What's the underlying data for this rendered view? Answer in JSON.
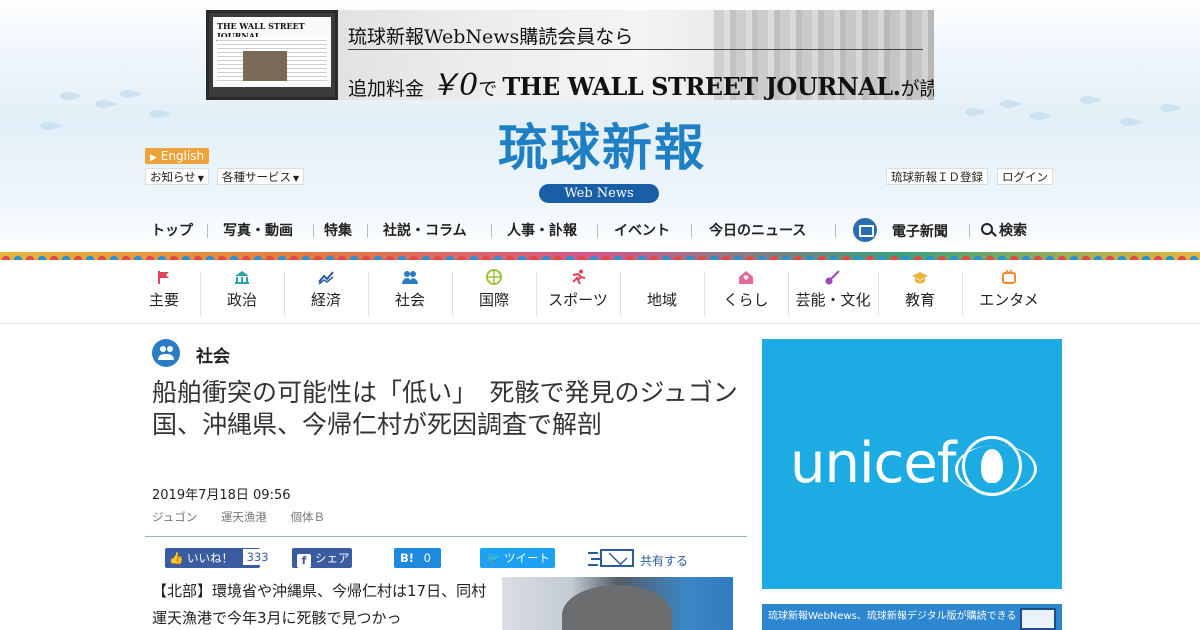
{
  "banner": {
    "line1": "琉球新報WebNews購読会員なら",
    "line2_prefix": "追加料金",
    "line2_yen": "￥0",
    "line2_de": "で",
    "line2_wsj": "THE WALL STREET JOURNAL.",
    "line2_suffix": "が読める",
    "laptop_masthead": "THE WALL STREET JOURNAL."
  },
  "masthead": {
    "logo": "琉球新報",
    "subtitle": "Web News",
    "english": "English",
    "notices": "お知らせ",
    "services": "各種サービス",
    "register": "琉球新報ＩＤ登録",
    "login": "ログイン"
  },
  "mainnav": {
    "items": [
      "トップ",
      "写真・動画",
      "特集",
      "社説・コラム",
      "人事・訃報",
      "イベント",
      "今日のニュース"
    ],
    "edition": "電子新聞",
    "search": "検索"
  },
  "categories": [
    {
      "label": "主要",
      "icon": "flag-icon",
      "color": "#e0455a"
    },
    {
      "label": "政治",
      "icon": "parliament-icon",
      "color": "#2aa4a6"
    },
    {
      "label": "経済",
      "icon": "chart-icon",
      "color": "#2a5d9e"
    },
    {
      "label": "社会",
      "icon": "people-icon",
      "color": "#2a7cc7"
    },
    {
      "label": "国際",
      "icon": "globe-icon",
      "color": "#9bc23c"
    },
    {
      "label": "スポーツ",
      "icon": "runner-icon",
      "color": "#e0455a"
    },
    {
      "label": "地域",
      "icon": "pin-icon",
      "color": "#4bb36b"
    },
    {
      "label": "くらし",
      "icon": "house-icon",
      "color": "#e06a9a"
    },
    {
      "label": "芸能・文化",
      "icon": "sanshin-icon",
      "color": "#9a4bb0"
    },
    {
      "label": "教育",
      "icon": "graduation-cap-icon",
      "color": "#e8b73c"
    },
    {
      "label": "エンタメ",
      "icon": "tv-icon",
      "color": "#f08a2a"
    }
  ],
  "article": {
    "section": "社会",
    "headline": "船舶衝突の可能性は「低い」　死骸で発見のジュゴン　国、沖縄県、今帰仁村が死因調査で解剖",
    "date": "2019年7月18日 09:56",
    "tags": [
      "ジュゴン",
      "運天漁港",
      "個体Ｂ"
    ],
    "body": "【北部】環境省や沖縄県、今帰仁村は17日、同村運天漁港で今年3月に死骸で見つかっ"
  },
  "share": {
    "like": "いいね！",
    "like_count": "333",
    "fb_share": "シェア",
    "hatena": "B!",
    "hatena_count": "0",
    "tweet": "ツイート",
    "mail": "共有する"
  },
  "sidebar": {
    "ad_word": "unicef",
    "promo": "琉球新報WebNews、琉球新報デジタル版が購読できる"
  }
}
